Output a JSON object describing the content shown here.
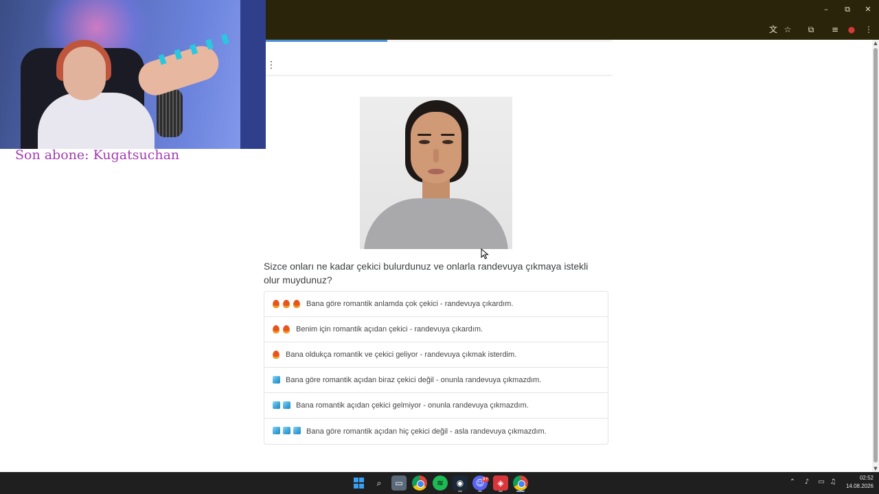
{
  "stream_overlay": {
    "latest_subscriber": "Son abone: Kugatsuchan"
  },
  "window": {
    "minimize_icon": "–",
    "restore_icon": "⧉",
    "close_icon": "✕"
  },
  "survey": {
    "progress_percent": 35,
    "question": "Sizce onları ne kadar çekici bulurdunuz ve onlarla randevuya çıkmaya istekli olur muydunuz?",
    "options": [
      {
        "fire": 3,
        "cube": 0,
        "label": "Bana göre romantik anlamda çok çekici - randevuya çıkardım."
      },
      {
        "fire": 2,
        "cube": 0,
        "label": "Benim için romantik açıdan çekici - randevuya çıkardım."
      },
      {
        "fire": 1,
        "cube": 0,
        "label": "Bana oldukça romantik ve çekici geliyor - randevuya çıkmak isterdim."
      },
      {
        "fire": 0,
        "cube": 1,
        "label": "Bana göre romantik açıdan biraz çekici değil - onunla randevuya çıkmazdım."
      },
      {
        "fire": 0,
        "cube": 2,
        "label": "Bana romantik açıdan çekici gelmiyor - onunla randevuya çıkmazdım."
      },
      {
        "fire": 0,
        "cube": 3,
        "label": "Bana göre romantik açıdan hiç çekici değil - asla randevuya çıkmazdım."
      }
    ]
  },
  "taskbar": {
    "discord_badge": "9+",
    "time": "02:52",
    "date": "14.08.2026"
  },
  "colors": {
    "overlay_text": "#a23ab1",
    "progress": "#4a90d9",
    "chrome_bg": "#2a240b"
  }
}
